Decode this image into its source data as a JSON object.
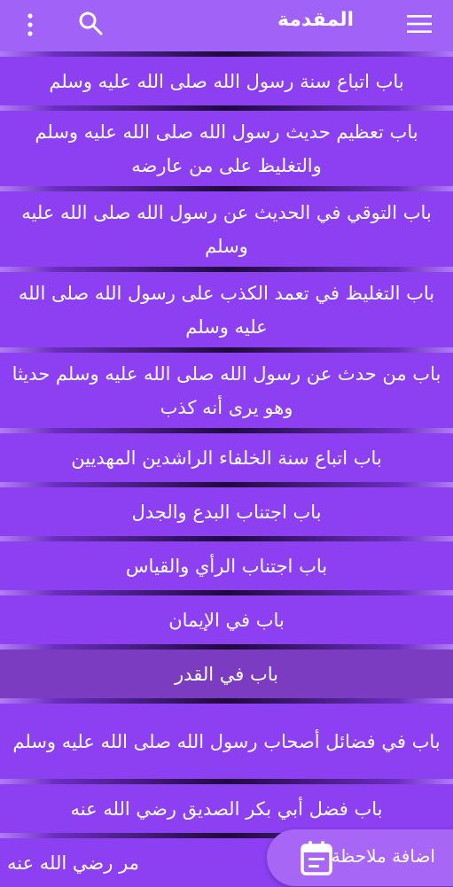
{
  "header": {
    "title": "المقدمة",
    "icons": [
      "menu-icon",
      "search-icon",
      "more-vert-icon"
    ]
  },
  "items": [
    {
      "label": "باب اتباع سنة رسول الله صلى الله عليه وسلم"
    },
    {
      "label": "باب تعظيم حديث رسول الله صلى الله عليه وسلم والتغليظ على من عارضه"
    },
    {
      "label": "باب التوقي في الحديث عن رسول الله صلى الله عليه وسلم"
    },
    {
      "label": "باب التغليظ في تعمد الكذب على رسول الله صلى الله عليه وسلم"
    },
    {
      "label": "باب من حدث عن رسول الله صلى الله عليه وسلم حديثا وهو يرى أنه كذب"
    },
    {
      "label": "باب اتباع سنة الخلفاء الراشدين المهديين"
    },
    {
      "label": "باب اجتناب البدع والجدل"
    },
    {
      "label": "باب اجتناب الرأي والقياس"
    },
    {
      "label": "باب في الإيمان"
    },
    {
      "label": "باب في القدر"
    },
    {
      "label": "باب في فضائل أصحاب رسول الله صلى الله عليه وسلم"
    },
    {
      "label": "باب فضل أبي بكر الصديق رضي الله عنه"
    },
    {
      "label": "مر رضي الله عنه"
    }
  ],
  "fab": {
    "label": "اضافة ملاحظة",
    "icon": "note-calendar-icon"
  },
  "colors": {
    "background": "#8c40f2",
    "appbar": "#a162f7",
    "highlight": "#7c3cc2",
    "fab": "#a866f7"
  }
}
